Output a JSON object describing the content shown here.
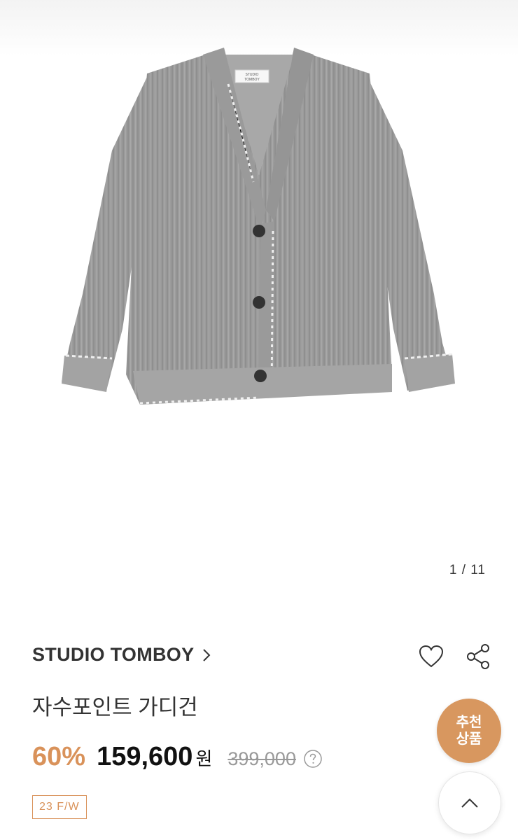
{
  "gallery": {
    "pager": "1 / 11",
    "image_label": "STUDIO TOMBOY"
  },
  "product": {
    "brand": "STUDIO TOMBOY",
    "title": "자수포인트 가디건",
    "discount": "60%",
    "sale_price": "159,600",
    "currency": "원",
    "original_price": "399,000",
    "season_badge": "23 F/W"
  },
  "actions": {
    "recommend_line1": "추천",
    "recommend_line2": "상품"
  },
  "colors": {
    "accent": "#d8975f",
    "sweater": "#9d9d9d"
  },
  "icons": [
    "chevron-right-icon",
    "heart-icon",
    "share-icon",
    "help-icon",
    "chevron-up-icon"
  ]
}
